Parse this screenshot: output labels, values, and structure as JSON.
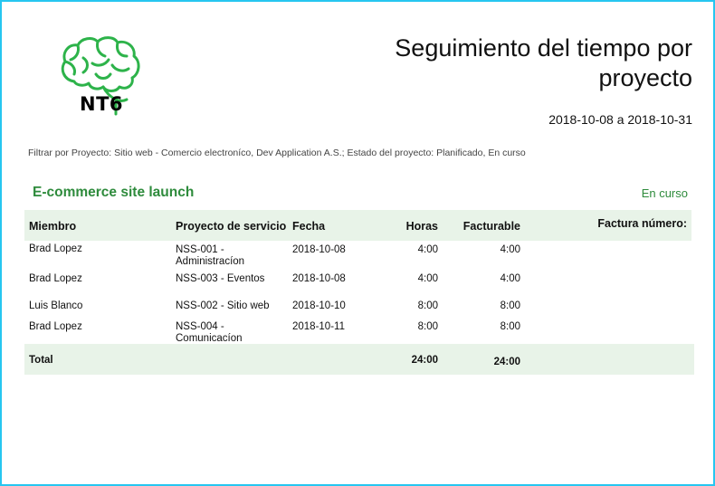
{
  "logo": {
    "text": "NT6",
    "icon": "brain-icon",
    "color": "#2db34a"
  },
  "report": {
    "title_line1": "Seguimiento del tiempo por",
    "title_line2": "proyecto",
    "date_range": "2018-10-08 a 2018-10-31",
    "filter": "Filtrar por Proyecto:  Sitio web - Comercio electroníco, Dev Application A.S.; Estado del proyecto: Planificado, En curso"
  },
  "project": {
    "name": "E-commerce site launch",
    "status": "En curso",
    "accent": "#2e8b3c"
  },
  "table": {
    "headers": {
      "member": "Miembro",
      "project": "Proyecto de servicio",
      "date": "Fecha",
      "hours": "Horas",
      "billable": "Facturable",
      "invoice": "Factura número:"
    },
    "rows": [
      {
        "member": "Brad Lopez",
        "project": "NSS-001 - Administracíon",
        "date": "2018-10-08",
        "hours": "4:00",
        "billable": "4:00",
        "invoice": ""
      },
      {
        "member": "Brad Lopez",
        "project": "NSS-003 - Eventos",
        "date": "2018-10-08",
        "hours": "4:00",
        "billable": "4:00",
        "invoice": ""
      },
      {
        "member": "Luis Blanco",
        "project": "NSS-002 - Sitio web",
        "date": "2018-10-10",
        "hours": "8:00",
        "billable": "8:00",
        "invoice": ""
      },
      {
        "member": "Brad Lopez",
        "project": "NSS-004 - Comunicacíon",
        "date": "2018-10-11",
        "hours": "8:00",
        "billable": "8:00",
        "invoice": ""
      }
    ],
    "total": {
      "label": "Total",
      "hours": "24:00",
      "billable": "24:00"
    }
  }
}
